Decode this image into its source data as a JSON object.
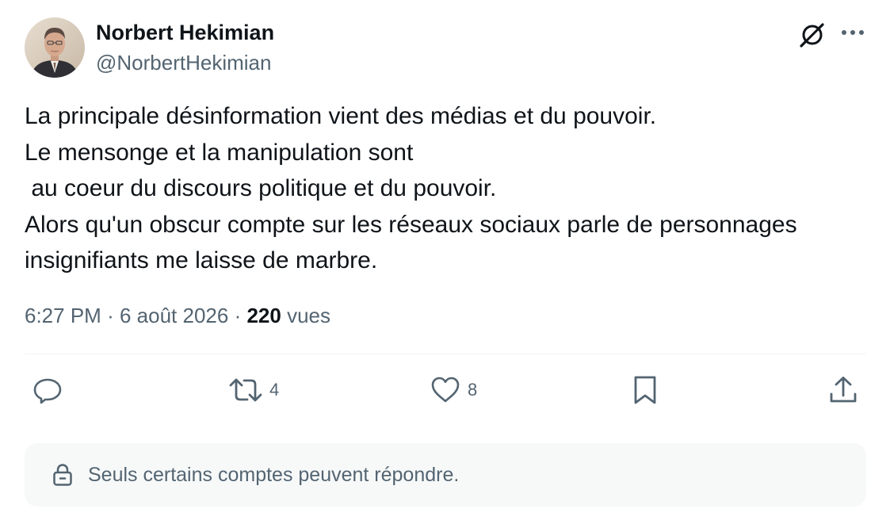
{
  "author": {
    "name": "Norbert Hekimian",
    "handle": "@NorbertHekimian"
  },
  "tweet": {
    "lines": [
      "La principale désinformation vient des médias et du pouvoir.",
      "Le mensonge et la manipulation sont",
      " au coeur du discours politique et du pouvoir.",
      "Alors qu'un obscur compte sur les réseaux sociaux parle de personnages",
      "insignifiants me laisse de marbre."
    ]
  },
  "meta": {
    "time": "6:27 PM",
    "separator": "·",
    "date": "6 août 2026",
    "views_count": "220",
    "views_label": "vues"
  },
  "actions": {
    "reply_count": "",
    "retweet_count": "4",
    "like_count": "8"
  },
  "reply_restriction": {
    "text": "Seuls certains comptes peuvent répondre."
  },
  "icons": {
    "grok": "grok-icon",
    "more": "more-icon",
    "reply": "reply-icon",
    "retweet": "retweet-icon",
    "like": "heart-icon",
    "bookmark": "bookmark-icon",
    "share": "share-icon",
    "lock": "lock-icon"
  },
  "colors": {
    "text_primary": "#0f1419",
    "text_secondary": "#536471",
    "divider": "#eff3f4",
    "reply_box_bg": "#f7f9f9"
  }
}
